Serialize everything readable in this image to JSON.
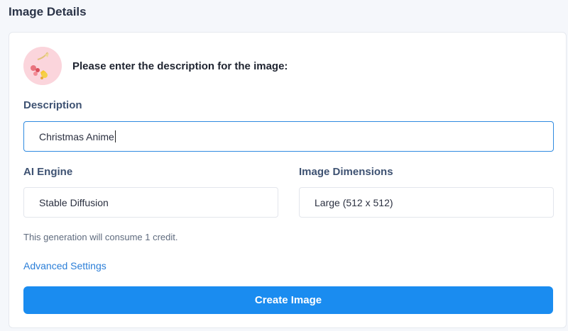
{
  "header": {
    "title": "Image Details"
  },
  "card": {
    "prompt": "Please enter the description for the image:",
    "avatar_icon": "christmas-ornament-icon",
    "description": {
      "label": "Description",
      "value": "Christmas Anime"
    },
    "engine": {
      "label": "AI Engine",
      "value": "Stable Diffusion"
    },
    "dimensions": {
      "label": "Image Dimensions",
      "value": "Large (512 x 512)"
    },
    "credit_note": "This generation will consume 1 credit.",
    "advanced_link": "Advanced Settings",
    "create_button": "Create Image"
  },
  "colors": {
    "accent": "#1a8cf0",
    "link": "#2a7ed8",
    "focus_border": "#2f8ae0"
  }
}
